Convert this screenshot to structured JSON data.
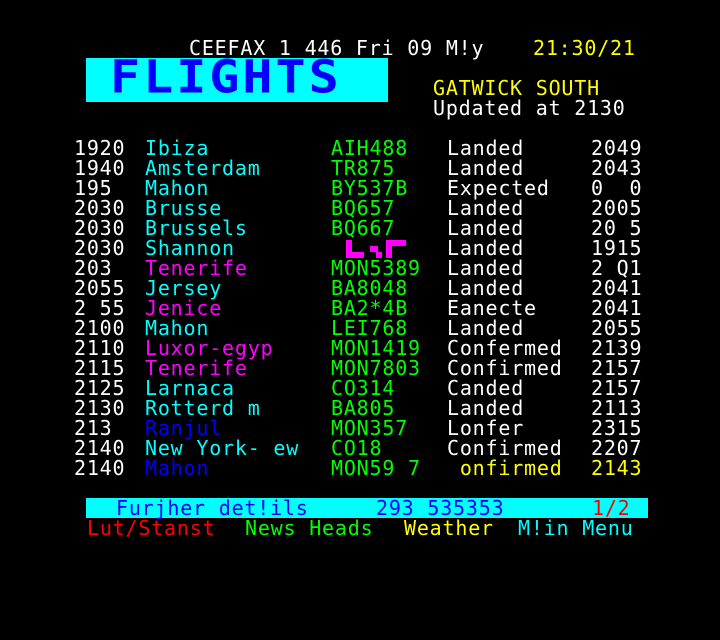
{
  "header": {
    "service": "CEEFAX 1 446 Fri 09 M!y",
    "clock": "21:30/21"
  },
  "banner": {
    "title": "FLIGHTS"
  },
  "airport": {
    "name": "GATWICK SOUTH",
    "updated": "Updated at 2130"
  },
  "flights": [
    {
      "time": "1920",
      "dest": "Ibiza",
      "dest_color": "#00ffff",
      "flight": "AIH488",
      "status": "Landed",
      "actual": "2049"
    },
    {
      "time": "1940",
      "dest": "Amsterdam",
      "dest_color": "#00ffff",
      "flight": "TR875",
      "status": "Landed",
      "actual": "2043"
    },
    {
      "time": "195",
      "dest": "Mahon",
      "dest_color": "#00ffff",
      "flight": "BY537B",
      "status": "Expected",
      "actual": "0  0"
    },
    {
      "time": "2030",
      "dest": "Brusse",
      "dest_color": "#00ffff",
      "flight": "BQ657",
      "status": "Landed",
      "actual": "2005"
    },
    {
      "time": "2030",
      "dest": "Brussels",
      "dest_color": "#00ffff",
      "flight": "BQ667",
      "status": "Landed",
      "actual": "20 5"
    },
    {
      "time": "2030",
      "dest": "Shannon",
      "dest_color": "#00ffff",
      "flight": "",
      "status": "Landed",
      "actual": "1915"
    },
    {
      "time": "203",
      "dest": "Tenerife",
      "dest_color": "#ff00ff",
      "flight": "MON5389",
      "status": "Landed",
      "actual": "2 Q1"
    },
    {
      "time": "2055",
      "dest": "Jersey",
      "dest_color": "#00ffff",
      "flight": "BA8048",
      "status": "Landed",
      "actual": "2041"
    },
    {
      "time": "2 55",
      "dest": "Jenice",
      "dest_color": "#ff00ff",
      "flight": "BA2*4B",
      "status": "Eanecte",
      "actual": "2041"
    },
    {
      "time": "2100",
      "dest": "Mahon",
      "dest_color": "#00ffff",
      "flight": "LEI768",
      "status": "Landed",
      "actual": "2055"
    },
    {
      "time": "2110",
      "dest": "Luxor-egyp",
      "dest_color": "#ff00ff",
      "flight": "MON1419",
      "status": "Confermed",
      "actual": "2139"
    },
    {
      "time": "2115",
      "dest": "Tenerife",
      "dest_color": "#ff00ff",
      "flight": "MON7803",
      "status": "Confirmed",
      "actual": "2157"
    },
    {
      "time": "2125",
      "dest": "Larnaca",
      "dest_color": "#00ffff",
      "flight": "CO314",
      "status": "Canded",
      "actual": "2157"
    },
    {
      "time": "2130",
      "dest": "Rotterd m",
      "dest_color": "#00ffff",
      "flight": "BA805",
      "status": "Landed",
      "actual": "2113"
    },
    {
      "time": "213",
      "dest": "Ranjul",
      "dest_color": "#0000ff",
      "flight": "MON357",
      "status": "Lonfer",
      "actual": "2315"
    },
    {
      "time": "2140",
      "dest": "New York- ew",
      "dest_color": "#00ffff",
      "flight": "CO18",
      "status": "Confirmed",
      "actual": "2207"
    },
    {
      "time": "2140",
      "dest": "Mahon",
      "dest_color": "#0000ff",
      "flight": "MON59 7",
      "status": " onfirmed",
      "actual": "2143",
      "status_color": "#ffff00",
      "actual_color": "#ffff00"
    }
  ],
  "info_bar": {
    "label": "Furjher det!ils",
    "phone": "293 535353",
    "page": "1/2"
  },
  "fastext": {
    "red": "Lut/Stanst",
    "green": "News Heads",
    "yellow": "Weather",
    "cyan": "M!in Menu"
  }
}
